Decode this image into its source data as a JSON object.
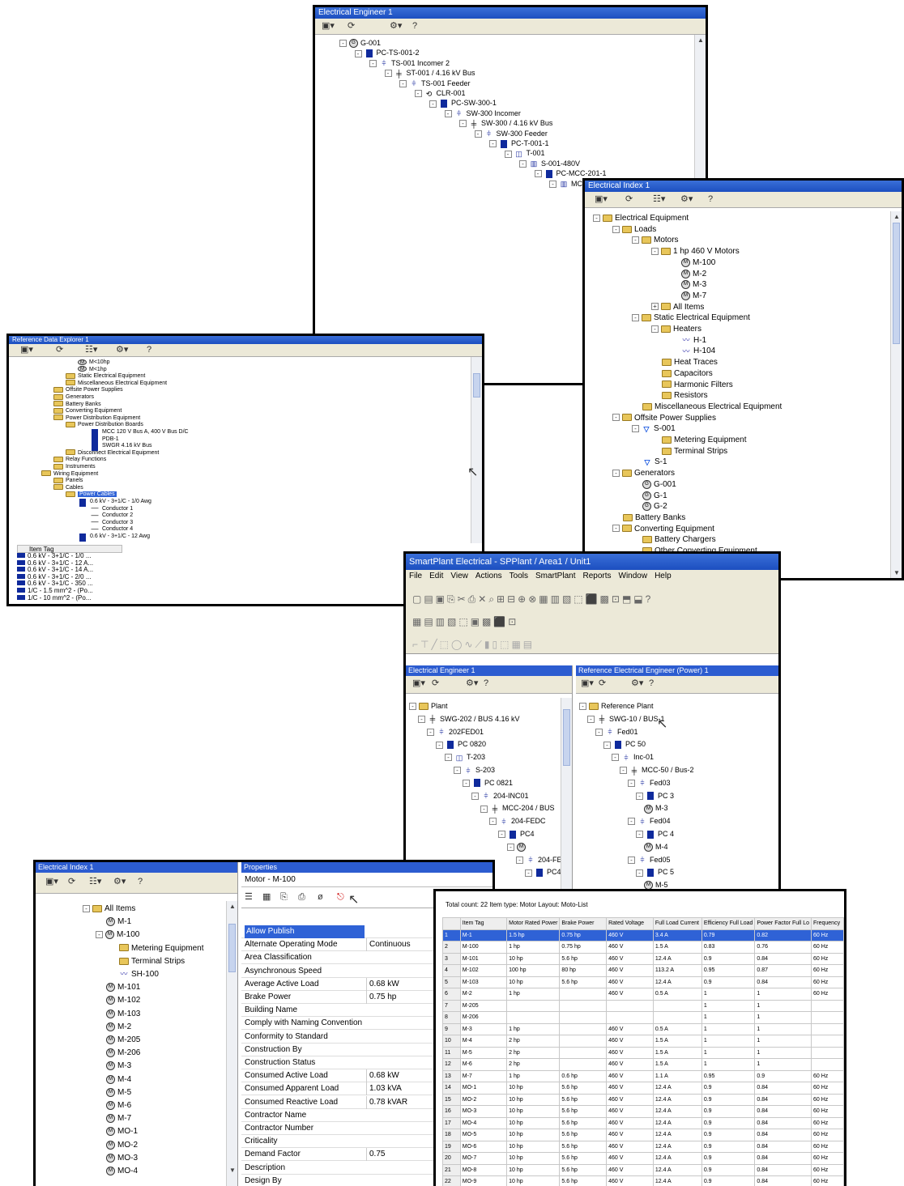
{
  "win_engineer": {
    "title": "Electrical Engineer 1",
    "toolbar": [
      "▾",
      "⟳",
      "⚙ ▾",
      "?"
    ],
    "tree": [
      {
        "label": "G-001",
        "icon": "generator-icon"
      },
      {
        "label": "PC-TS-001-2",
        "icon": "pc-icon"
      },
      {
        "label": "TS-001 Incomer 2",
        "icon": "incomer-icon"
      },
      {
        "label": "ST-001 / 4.16 kV Bus",
        "icon": "bus-icon"
      },
      {
        "label": "TS-001 Feeder",
        "icon": "feeder-icon"
      },
      {
        "label": "CLR-001",
        "icon": "cable-icon"
      },
      {
        "label": "PC-SW-300-1",
        "icon": "pc-icon"
      },
      {
        "label": "SW-300 Incomer",
        "icon": "incomer-icon"
      },
      {
        "label": "SW-300 / 4.16 kV Bus",
        "icon": "bus-icon"
      },
      {
        "label": "SW-300 Feeder",
        "icon": "feeder-icon"
      },
      {
        "label": "PC-T-001-1",
        "icon": "pc-icon"
      },
      {
        "label": "T-001",
        "icon": "transformer-icon"
      },
      {
        "label": "S-001-480V",
        "icon": "switch-icon"
      },
      {
        "label": "PC-MCC-201-1",
        "icon": "pc-icon"
      },
      {
        "label": "MCC",
        "icon": "mcc-icon"
      }
    ]
  },
  "win_index": {
    "title": "Electrical Index 1",
    "tree": [
      {
        "label": "Electrical Equipment",
        "icon": "folder",
        "pm": "-"
      },
      {
        "label": "Loads",
        "icon": "folder",
        "pm": "-"
      },
      {
        "label": "Motors",
        "icon": "folder",
        "pm": "-"
      },
      {
        "label": "1 hp 460 V Motors",
        "icon": "folder",
        "pm": "-"
      },
      {
        "label": "M-100",
        "icon": "motor",
        "pm": ""
      },
      {
        "label": "M-2",
        "icon": "motor",
        "pm": ""
      },
      {
        "label": "M-3",
        "icon": "motor",
        "pm": ""
      },
      {
        "label": "M-7",
        "icon": "motor",
        "pm": ""
      },
      {
        "label": "All Items",
        "icon": "folder",
        "pm": "+"
      },
      {
        "label": "Static Electrical Equipment",
        "icon": "folder",
        "pm": "-"
      },
      {
        "label": "Heaters",
        "icon": "folder",
        "pm": "-"
      },
      {
        "label": "H-1",
        "icon": "heater",
        "pm": ""
      },
      {
        "label": "H-104",
        "icon": "heater",
        "pm": ""
      },
      {
        "label": "Heat Traces",
        "icon": "folder",
        "pm": ""
      },
      {
        "label": "Capacitors",
        "icon": "folder",
        "pm": ""
      },
      {
        "label": "Harmonic Filters",
        "icon": "folder",
        "pm": ""
      },
      {
        "label": "Resistors",
        "icon": "folder",
        "pm": ""
      },
      {
        "label": "Miscellaneous Electrical Equipment",
        "icon": "folder",
        "pm": ""
      },
      {
        "label": "Offsite Power Supplies",
        "icon": "folder",
        "pm": "-"
      },
      {
        "label": "S-001",
        "icon": "supply",
        "pm": "-"
      },
      {
        "label": "Metering Equipment",
        "icon": "folder",
        "pm": ""
      },
      {
        "label": "Terminal Strips",
        "icon": "folder",
        "pm": ""
      },
      {
        "label": "S-1",
        "icon": "supply",
        "pm": ""
      },
      {
        "label": "Generators",
        "icon": "folder",
        "pm": "-"
      },
      {
        "label": "G-001",
        "icon": "gen",
        "pm": ""
      },
      {
        "label": "G-1",
        "icon": "gen",
        "pm": ""
      },
      {
        "label": "G-2",
        "icon": "gen",
        "pm": ""
      },
      {
        "label": "Battery Banks",
        "icon": "folder",
        "pm": ""
      },
      {
        "label": "Converting Equipment",
        "icon": "folder",
        "pm": "-"
      },
      {
        "label": "Battery Chargers",
        "icon": "folder",
        "pm": ""
      },
      {
        "label": "Other Converting Equipment",
        "icon": "folder",
        "pm": ""
      }
    ]
  },
  "win_refdata": {
    "title": "Reference Data Explorer 1",
    "tree": [
      {
        "label": "M<10hp",
        "icon": "motor"
      },
      {
        "label": "M<1hp",
        "icon": "motor"
      },
      {
        "label": "Static Electrical Equipment",
        "icon": "folder"
      },
      {
        "label": "Miscellaneous Electrical Equipment",
        "icon": "folder"
      },
      {
        "label": "Offsite Power Supplies",
        "icon": "folder"
      },
      {
        "label": "Generators",
        "icon": "folder"
      },
      {
        "label": "Battery Banks",
        "icon": "folder"
      },
      {
        "label": "Converting Equipment",
        "icon": "folder"
      },
      {
        "label": "Power Distribution Equipment",
        "icon": "folder"
      },
      {
        "label": "Power Distribution Boards",
        "icon": "folder"
      },
      {
        "label": "MCC 120 V Bus A, 400 V Bus D/C",
        "icon": "board"
      },
      {
        "label": "PDB-1",
        "icon": "board"
      },
      {
        "label": "SWGR 4.16 kV Bus",
        "icon": "board"
      },
      {
        "label": "Disconnect Electrical Equipment",
        "icon": "folder"
      },
      {
        "label": "Relay Functions",
        "icon": "folder"
      },
      {
        "label": "Instruments",
        "icon": "folder"
      },
      {
        "label": "Wiring Equipment",
        "icon": "folder"
      },
      {
        "label": "Panels",
        "icon": "folder"
      },
      {
        "label": "Cables",
        "icon": "folder"
      },
      {
        "label": "Power Cables",
        "icon": "folder",
        "sel": true
      },
      {
        "label": "0.6 kV - 3+1/C - 1/0 Awg",
        "icon": "cable"
      },
      {
        "label": "Conductor 1",
        "icon": "wire"
      },
      {
        "label": "Conductor 2",
        "icon": "wire"
      },
      {
        "label": "Conductor 3",
        "icon": "wire"
      },
      {
        "label": "Conductor 4",
        "icon": "wire"
      },
      {
        "label": "0.6 kV - 3+1/C - 12 Awg",
        "icon": "cable"
      }
    ],
    "list_header": "Item Tag",
    "list": [
      "0.6 kV - 3+1/C - 1/0 ...",
      "0.6 kV - 3+1/C - 12 A...",
      "0.6 kV - 3+1/C - 14 A...",
      "0.6 kV - 3+1/C - 2/0 ...",
      "0.6 kV - 3+1/C - 350 ...",
      "1/C - 1.5 mm^2 - (Po...",
      "1/C - 10 mm^2 - (Po..."
    ]
  },
  "win_main": {
    "title": "SmartPlant Electrical - SPPlant / Area1 / Unit1",
    "menu": [
      "File",
      "Edit",
      "View",
      "Actions",
      "Tools",
      "SmartPlant",
      "Reports",
      "Window",
      "Help"
    ],
    "left_title": "Electrical Engineer 1",
    "right_title": "Reference Electrical Engineer (Power) 1",
    "left_tree": [
      {
        "label": "Plant",
        "icon": "folder"
      },
      {
        "label": "SWG-202 / BUS 4.16 kV",
        "icon": "bus"
      },
      {
        "label": "202FED01",
        "icon": "feeder"
      },
      {
        "label": "PC 0820",
        "icon": "pc"
      },
      {
        "label": "T-203",
        "icon": "transformer"
      },
      {
        "label": "S-203",
        "icon": "feeder"
      },
      {
        "label": "PC 0821",
        "icon": "pc"
      },
      {
        "label": "204-INC01",
        "icon": "feeder"
      },
      {
        "label": "MCC-204 / BUS",
        "icon": "bus"
      },
      {
        "label": "204-FEDC",
        "icon": "feeder"
      },
      {
        "label": "PC4",
        "icon": "pc"
      },
      {
        "label": "",
        "icon": "motor"
      },
      {
        "label": "204-FEDC",
        "icon": "feeder"
      },
      {
        "label": "PC4",
        "icon": "pc"
      }
    ],
    "right_tree": [
      {
        "label": "Reference Plant",
        "icon": "folder"
      },
      {
        "label": "SWG-10 / BUS-1",
        "icon": "bus"
      },
      {
        "label": "Fed01",
        "icon": "feeder"
      },
      {
        "label": "PC 50",
        "icon": "pc"
      },
      {
        "label": "Inc-01",
        "icon": "feeder"
      },
      {
        "label": "MCC-50 / Bus-2",
        "icon": "bus"
      },
      {
        "label": "Fed03",
        "icon": "feeder"
      },
      {
        "label": "PC 3",
        "icon": "pc"
      },
      {
        "label": "M-3",
        "icon": "motor"
      },
      {
        "label": "Fed04",
        "icon": "feeder"
      },
      {
        "label": "PC 4",
        "icon": "pc"
      },
      {
        "label": "M-4",
        "icon": "motor"
      },
      {
        "label": "Fed05",
        "icon": "feeder"
      },
      {
        "label": "PC 5",
        "icon": "pc"
      },
      {
        "label": "M-5",
        "icon": "motor"
      }
    ]
  },
  "win_props": {
    "left_title": "Electrical Index 1",
    "right_title": "Properties",
    "object": "Motor - M-100",
    "tree": [
      {
        "label": "All Items",
        "icon": "folder"
      },
      {
        "label": "M-1",
        "icon": "motor"
      },
      {
        "label": "M-100",
        "icon": "motor"
      },
      {
        "label": "Metering Equipment",
        "icon": "folder"
      },
      {
        "label": "Terminal Strips",
        "icon": "folder"
      },
      {
        "label": "SH-100",
        "icon": "heater"
      },
      {
        "label": "M-101",
        "icon": "motor"
      },
      {
        "label": "M-102",
        "icon": "motor"
      },
      {
        "label": "M-103",
        "icon": "motor"
      },
      {
        "label": "M-2",
        "icon": "motor"
      },
      {
        "label": "M-205",
        "icon": "motor"
      },
      {
        "label": "M-206",
        "icon": "motor"
      },
      {
        "label": "M-3",
        "icon": "motor"
      },
      {
        "label": "M-4",
        "icon": "motor"
      },
      {
        "label": "M-5",
        "icon": "motor"
      },
      {
        "label": "M-6",
        "icon": "motor"
      },
      {
        "label": "M-7",
        "icon": "motor"
      },
      {
        "label": "MO-1",
        "icon": "motor"
      },
      {
        "label": "MO-2",
        "icon": "motor"
      },
      {
        "label": "MO-3",
        "icon": "motor"
      },
      {
        "label": "MO-4",
        "icon": "motor"
      }
    ],
    "props": [
      {
        "name": "Allow Publish",
        "value": "",
        "sel": true
      },
      {
        "name": "Alternate Operating Mode",
        "value": "Continuous"
      },
      {
        "name": "Area Classification",
        "value": ""
      },
      {
        "name": "Asynchronous Speed",
        "value": ""
      },
      {
        "name": "Average Active Load",
        "value": "0.68 kW"
      },
      {
        "name": "Brake Power",
        "value": "0.75 hp"
      },
      {
        "name": "Building Name",
        "value": ""
      },
      {
        "name": "Comply with Naming Convention",
        "value": ""
      },
      {
        "name": "Conformity to Standard",
        "value": ""
      },
      {
        "name": "Construction By",
        "value": ""
      },
      {
        "name": "Construction Status",
        "value": ""
      },
      {
        "name": "Consumed Active Load",
        "value": "0.68 kW"
      },
      {
        "name": "Consumed Apparent Load",
        "value": "1.03 kVA"
      },
      {
        "name": "Consumed Reactive Load",
        "value": "0.78 kVAR"
      },
      {
        "name": "Contractor Name",
        "value": ""
      },
      {
        "name": "Contractor Number",
        "value": ""
      },
      {
        "name": "Criticality",
        "value": ""
      },
      {
        "name": "Demand Factor",
        "value": "0.75"
      },
      {
        "name": "Description",
        "value": ""
      },
      {
        "name": "Design By",
        "value": ""
      }
    ]
  },
  "win_list": {
    "summary": "Total count: 22   Item type: Motor   Layout: Moto-List",
    "columns": [
      "",
      "Item Tag",
      "Motor Rated Power",
      "Brake Power",
      "Rated Voltage",
      "Full Load Current",
      "Efficiency Full Load",
      "Power Factor Full Lo",
      "Frequency"
    ],
    "rows": [
      [
        "1",
        "M-1",
        "1.5 hp",
        "0.75 hp",
        "460 V",
        "3.4 A",
        "0.79",
        "0.82",
        "60 Hz"
      ],
      [
        "2",
        "M-100",
        "1 hp",
        "0.75 hp",
        "460 V",
        "1.5 A",
        "0.83",
        "0.76",
        "60 Hz"
      ],
      [
        "3",
        "M-101",
        "10 hp",
        "5.6 hp",
        "460 V",
        "12.4 A",
        "0.9",
        "0.84",
        "60 Hz"
      ],
      [
        "4",
        "M-102",
        "100 hp",
        "80 hp",
        "460 V",
        "113.2 A",
        "0.95",
        "0.87",
        "60 Hz"
      ],
      [
        "5",
        "M-103",
        "10 hp",
        "5.6 hp",
        "460 V",
        "12.4 A",
        "0.9",
        "0.84",
        "60 Hz"
      ],
      [
        "6",
        "M-2",
        "1 hp",
        "",
        "460 V",
        "0.5 A",
        "1",
        "1",
        "60 Hz"
      ],
      [
        "7",
        "M-205",
        "",
        "",
        "",
        "",
        "1",
        "1",
        ""
      ],
      [
        "8",
        "M-206",
        "",
        "",
        "",
        "",
        "1",
        "1",
        ""
      ],
      [
        "9",
        "M-3",
        "1 hp",
        "",
        "460 V",
        "0.5 A",
        "1",
        "1",
        ""
      ],
      [
        "10",
        "M-4",
        "2 hp",
        "",
        "460 V",
        "1.5 A",
        "1",
        "1",
        ""
      ],
      [
        "11",
        "M-5",
        "2 hp",
        "",
        "460 V",
        "1.5 A",
        "1",
        "1",
        ""
      ],
      [
        "12",
        "M-6",
        "2 hp",
        "",
        "460 V",
        "1.5 A",
        "1",
        "1",
        ""
      ],
      [
        "13",
        "M-7",
        "1 hp",
        "0.6 hp",
        "460 V",
        "1.1 A",
        "0.95",
        "0.9",
        "60 Hz"
      ],
      [
        "14",
        "MO-1",
        "10 hp",
        "5.6 hp",
        "460 V",
        "12.4 A",
        "0.9",
        "0.84",
        "60 Hz"
      ],
      [
        "15",
        "MO-2",
        "10 hp",
        "5.6 hp",
        "460 V",
        "12.4 A",
        "0.9",
        "0.84",
        "60 Hz"
      ],
      [
        "16",
        "MO-3",
        "10 hp",
        "5.6 hp",
        "460 V",
        "12.4 A",
        "0.9",
        "0.84",
        "60 Hz"
      ],
      [
        "17",
        "MO-4",
        "10 hp",
        "5.6 hp",
        "460 V",
        "12.4 A",
        "0.9",
        "0.84",
        "60 Hz"
      ],
      [
        "18",
        "MO-5",
        "10 hp",
        "5.6 hp",
        "460 V",
        "12.4 A",
        "0.9",
        "0.84",
        "60 Hz"
      ],
      [
        "19",
        "MO-6",
        "10 hp",
        "5.6 hp",
        "460 V",
        "12.4 A",
        "0.9",
        "0.84",
        "60 Hz"
      ],
      [
        "20",
        "MO-7",
        "10 hp",
        "5.6 hp",
        "460 V",
        "12.4 A",
        "0.9",
        "0.84",
        "60 Hz"
      ],
      [
        "21",
        "MO-8",
        "10 hp",
        "5.6 hp",
        "460 V",
        "12.4 A",
        "0.9",
        "0.84",
        "60 Hz"
      ],
      [
        "22",
        "MO-9",
        "10 hp",
        "5.6 hp",
        "460 V",
        "12.4 A",
        "0.9",
        "0.84",
        "60 Hz"
      ]
    ]
  }
}
